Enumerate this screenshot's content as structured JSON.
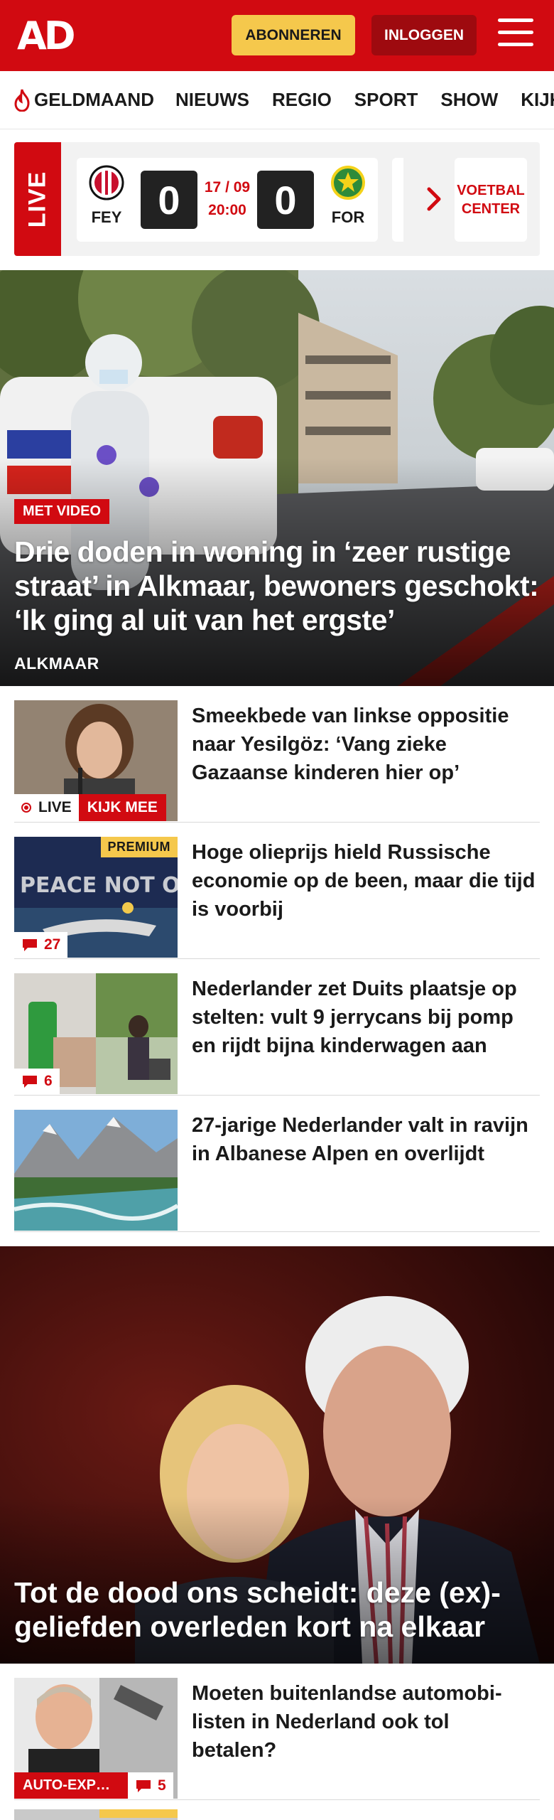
{
  "header": {
    "logo": "AD",
    "subscribe_label": "ABONNEREN",
    "login_label": "INLOGGEN"
  },
  "nav": {
    "items": [
      "GELDMAAND",
      "NIEUWS",
      "REGIO",
      "SPORT",
      "SHOW",
      "KIJK"
    ]
  },
  "live": {
    "label": "LIVE",
    "home_team": "FEY",
    "away_team": "FOR",
    "home_score": "0",
    "away_score": "0",
    "date": "17 / 09",
    "time": "20:00",
    "voetbal_center": "VOETBAL CENTER"
  },
  "hero": {
    "badge": "MET VIDEO",
    "title": "Drie doden in woning in ‘zeer rustige straat’ in Alkmaar, bewoners geschokt: ‘Ik ging al uit van het ergste’",
    "location": "ALKMAAR"
  },
  "articles": [
    {
      "title": "Smeekbede van linkse oppositie naar Yesilgöz: ‘Vang zieke Gazaanse kinderen hier op’",
      "live_label": "LIVE",
      "kijk_label": "KIJK MEE"
    },
    {
      "title": "Hoge olieprijs hield Russische economie op de been, maar die tijd is voorbij",
      "premium_label": "PREMIUM",
      "comments": "27",
      "image_text": "PEACE NOT OIL"
    },
    {
      "title": "Nederlander zet Duits plaatsje op stelten: vult 9 jerrycans bij pomp en rijdt bijna kinderwagen aan",
      "comments": "6"
    },
    {
      "title": "27-jarige Nederlander valt in ravijn in Albanese Alpen en overlijdt"
    }
  ],
  "feature": {
    "title": "Tot de dood ons scheidt: deze (ex)-geliefden overleden kort na elkaar"
  },
  "article_after": {
    "title": "Moeten buitenlandse automobi- listen in Nederland ook tol betalen?",
    "badge": "AUTO-EXPERT",
    "comments": "5"
  },
  "colors": {
    "brand_red": "#d10a11",
    "subscribe_yellow": "#f5c84c",
    "login_dark_red": "#9e0a0f"
  }
}
